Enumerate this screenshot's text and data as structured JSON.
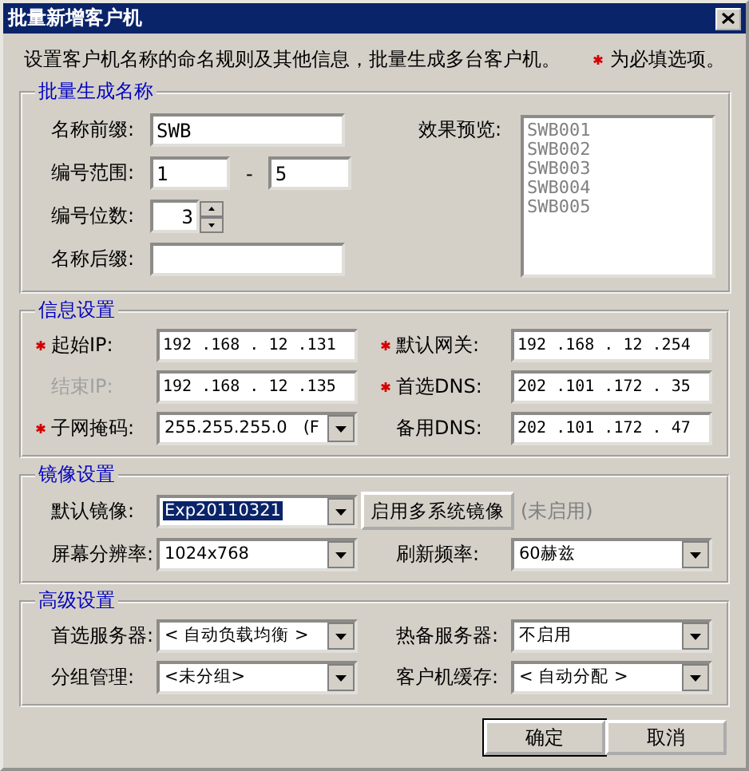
{
  "window": {
    "title": "批量新增客户机"
  },
  "intro": "设置客户机名称的命名规则及其他信息，批量生成多台客户机。",
  "required_note": "为必填选项。",
  "name_group": {
    "legend": "批量生成名称",
    "prefix": {
      "label": "名称前缀:",
      "value": "SWB"
    },
    "range": {
      "label": "编号范围:",
      "from": "1",
      "separator": "-",
      "to": "5"
    },
    "digits": {
      "label": "编号位数:",
      "value": "3"
    },
    "suffix": {
      "label": "名称后缀:"
    },
    "preview": {
      "label": "效果预览:",
      "items": [
        "SWB001",
        "SWB002",
        "SWB003",
        "SWB004",
        "SWB005"
      ]
    }
  },
  "info_group": {
    "legend": "信息设置",
    "fields": [
      {
        "label": "起始IP:",
        "required": true,
        "disabled": false,
        "kind": "ip",
        "value": "192 .168 . 12 .131"
      },
      {
        "label": "默认网关:",
        "required": true,
        "disabled": false,
        "kind": "ip",
        "value": "192 .168 . 12 .254"
      },
      {
        "label": "结束IP:",
        "required": false,
        "disabled": true,
        "kind": "ip",
        "value": "192 .168 . 12 .135"
      },
      {
        "label": "首选DNS:",
        "required": true,
        "disabled": false,
        "kind": "ip",
        "value": "202 .101 .172 . 35"
      },
      {
        "label": "子网掩码:",
        "required": true,
        "disabled": false,
        "kind": "combo",
        "value": "255.255.255.0   (F"
      },
      {
        "label": "备用DNS:",
        "required": false,
        "disabled": false,
        "kind": "ip",
        "value": "202 .101 .172 . 47"
      }
    ]
  },
  "image_group": {
    "legend": "镜像设置",
    "default_image": {
      "label": "默认镜像:",
      "value": "Exp20110321",
      "selected": true
    },
    "multi_button": "启用多系统镜像",
    "multi_status": "(未启用)",
    "resolution": {
      "label": "屏幕分辨率:",
      "value": "1024x768"
    },
    "refresh": {
      "label": "刷新频率:",
      "value": "60赫兹"
    }
  },
  "advanced_group": {
    "legend": "高级设置",
    "fields": [
      {
        "label": "首选服务器:",
        "value": "< 自动负载均衡 >"
      },
      {
        "label": "热备服务器:",
        "value": "不启用"
      },
      {
        "label": "分组管理:",
        "value": "<未分组>"
      },
      {
        "label": "客户机缓存:",
        "value": "< 自动分配 >"
      }
    ]
  },
  "buttons": [
    {
      "label": "确定",
      "default": true
    },
    {
      "label": "取消",
      "default": false
    }
  ]
}
